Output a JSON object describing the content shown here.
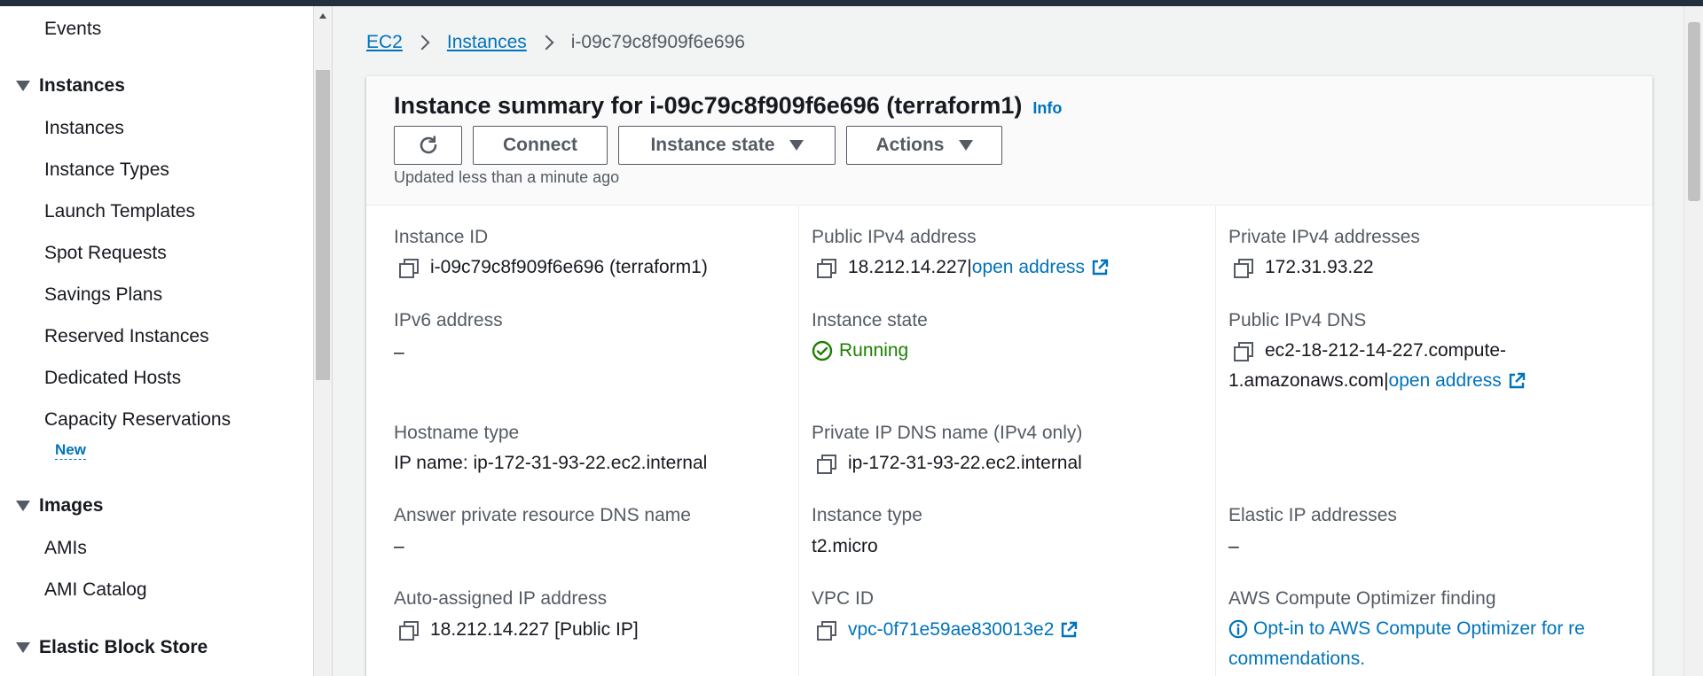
{
  "sidebar": {
    "events": "Events",
    "instances_section": "Instances",
    "instances_items": [
      "Instances",
      "Instance Types",
      "Launch Templates",
      "Spot Requests",
      "Savings Plans",
      "Reserved Instances",
      "Dedicated Hosts",
      "Capacity Reservations"
    ],
    "new_badge": "New",
    "images_section": "Images",
    "images_items": [
      "AMIs",
      "AMI Catalog"
    ],
    "ebs_section": "Elastic Block Store"
  },
  "breadcrumb": {
    "ec2": "EC2",
    "instances": "Instances",
    "current": "i-09c79c8f909f6e696"
  },
  "summary": {
    "title": "Instance summary for i-09c79c8f909f6e696 (terraform1)",
    "info": "Info",
    "connect": "Connect",
    "instance_state_btn": "Instance state",
    "actions_btn": "Actions",
    "updated": "Updated less than a minute ago"
  },
  "fields": {
    "instance_id_label": "Instance ID",
    "instance_id_value": "i-09c79c8f909f6e696 (terraform1)",
    "public_ipv4_label": "Public IPv4 address",
    "public_ipv4_value": "18.212.14.227",
    "public_ipv4_sep": " |",
    "open_address": "open address",
    "private_ipv4_label": "Private IPv4 addresses",
    "private_ipv4_value": "172.31.93.22",
    "ipv6_label": "IPv6 address",
    "ipv6_value": "–",
    "instance_state_label": "Instance state",
    "instance_state_value": "Running",
    "public_dns_label": "Public IPv4 DNS",
    "public_dns_line1": "ec2-18-212-14-227.compute-",
    "public_dns_line2": "1.amazonaws.com",
    "public_dns_sep": " |",
    "hostname_label": "Hostname type",
    "hostname_value": "IP name: ip-172-31-93-22.ec2.internal",
    "private_dns_label": "Private IP DNS name (IPv4 only)",
    "private_dns_value": "ip-172-31-93-22.ec2.internal",
    "answer_dns_label": "Answer private resource DNS name",
    "answer_dns_value": "–",
    "instance_type_label": "Instance type",
    "instance_type_value": "t2.micro",
    "elastic_ip_label": "Elastic IP addresses",
    "elastic_ip_value": "–",
    "auto_ip_label": "Auto-assigned IP address",
    "auto_ip_value": "18.212.14.227 [Public IP]",
    "vpc_label": "VPC ID",
    "vpc_value": "vpc-0f71e59ae830013e2",
    "optimizer_label": "AWS Compute Optimizer finding",
    "optimizer_line1": "Opt-in to AWS Compute Optimizer for re",
    "optimizer_line2": "commendations."
  },
  "colors": {
    "link": "#0073bb",
    "running": "#1d8102",
    "topbar": "#232f3e"
  }
}
